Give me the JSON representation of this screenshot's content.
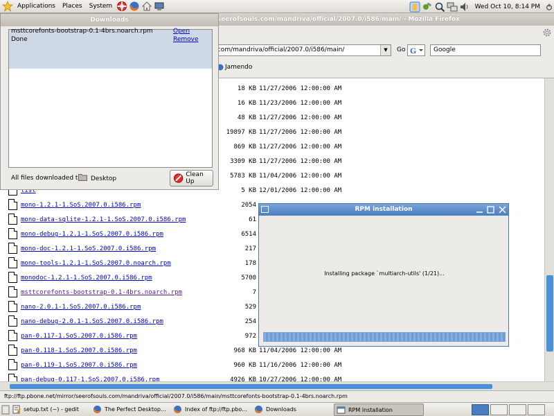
{
  "top_panel": {
    "menus": [
      "Applications",
      "Places",
      "System"
    ],
    "launcher_icons": [
      "lifebuoy-icon",
      "firefox-icon",
      "home-icon",
      "computer-icon"
    ],
    "tray_icons": [
      "update-notifier-icon",
      "tools-icon",
      "search-icon",
      "network-icon",
      "volume-icon"
    ],
    "clock": "Wed Oct 10,  8:14 PM"
  },
  "firefox": {
    "title": "Index of ftp://ftp.pbone.net/mirror/seerofsouls.com/mandriva/official/2007.0/i586/main/ - Mozilla Firefox",
    "url": "ftp://ftp.pbone.net/mirror/seerofsouls.com/mandriva/official/2007.0/i586/main/",
    "url_visible": ".com/mandriva/official/2007.0/i586/main/",
    "go_label": "Go",
    "search_text": "Google",
    "bookmark": "Jamendo",
    "status": "ftp://ftp.pbone.net/mirror/seerofsouls.com/mandriva/official/2007.0/i586/main/msttcorefonts-bootstrap-0.1-4brs.noarch.rpm"
  },
  "listing": [
    {
      "name": "",
      "size": "18 KB",
      "date": "11/27/2006 12:00:00 AM"
    },
    {
      "name": "",
      "size": "16 KB",
      "date": "11/23/2006 12:00:00 AM"
    },
    {
      "name": "",
      "size": "48 KB",
      "date": "11/27/2006 12:00:00 AM"
    },
    {
      "name": "",
      "size": "19897 KB",
      "date": "11/27/2006 12:00:00 AM"
    },
    {
      "name": "",
      "size": "869 KB",
      "date": "11/27/2006 12:00:00 AM"
    },
    {
      "name": "",
      "size": "3309 KB",
      "date": "11/27/2006 12:00:00 AM"
    },
    {
      "name": "",
      "size": "5783 KB",
      "date": "11/04/2006 12:00:00 AM"
    },
    {
      "name": "list",
      "size": "5 KB",
      "date": "12/01/2006 12:00:00 AM"
    },
    {
      "name": "mono-1.2.1-1.SoS.2007.0.i586.rpm",
      "size": "2054",
      "date": ""
    },
    {
      "name": "mono-data-sqlite-1.2.1-1.SoS.2007.0.i586.rpm",
      "size": "61",
      "date": ""
    },
    {
      "name": "mono-debug-1.2.1-1.SoS.2007.0.i586.rpm",
      "size": "6514",
      "date": ""
    },
    {
      "name": "mono-doc-1.2.1-1.SoS.2007.0.i586.rpm",
      "size": "217",
      "date": ""
    },
    {
      "name": "mono-tools-1.2.1-1.SoS.2007.0.noarch.rpm",
      "size": "178",
      "date": ""
    },
    {
      "name": "monodoc-1.2.1-1.SoS.2007.0.i586.rpm",
      "size": "5700",
      "date": ""
    },
    {
      "name": "msttcorefonts-bootstrap-0.1-4brs.noarch.rpm",
      "size": "7",
      "date": "",
      "visited": true
    },
    {
      "name": "nano-2.0.1-1.SoS.2007.0.i586.rpm",
      "size": "529",
      "date": ""
    },
    {
      "name": "nano-debug-2.0.1-1.SoS.2007.0.i586.rpm",
      "size": "254",
      "date": ""
    },
    {
      "name": "pan-0.117-1.SoS.2007.0.i586.rpm",
      "size": "972",
      "date": ""
    },
    {
      "name": "pan-0.118-1.SoS.2007.0.i586.rpm",
      "size": "968 KB",
      "date": "11/04/2006 12:00:00 AM"
    },
    {
      "name": "pan-0.119-1.SoS.2007.0.i586.rpm",
      "size": "960 KB",
      "date": "11/16/2006 12:00:00 AM"
    },
    {
      "name": "pan-debug-0.117-1.SoS.2007.0.i586.rpm",
      "size": "4926 KB",
      "date": "10/27/2006 12:00:00 AM"
    }
  ],
  "downloads": {
    "title": "Downloads",
    "filename": "msttcorefonts-bootstrap-0.1-4brs.noarch.rpm",
    "status": "Done",
    "open": "Open",
    "remove": "Remove",
    "footer_label": "All files downloaded to:",
    "folder": "Desktop",
    "cleanup": "Clean Up"
  },
  "rpm": {
    "title": "RPM installation",
    "message": "Installing package `multiarch-utils' (1/21)...",
    "progress": 1.0
  },
  "taskbar": {
    "tasks": [
      {
        "label": "setup.txt (~) - gedit",
        "icon": "text-editor-icon"
      },
      {
        "label": "The Perfect Desktop...",
        "icon": "firefox-icon"
      },
      {
        "label": "Index of ftp://ftp.pbo...",
        "icon": "firefox-icon"
      },
      {
        "label": "Downloads",
        "icon": "firefox-icon"
      },
      {
        "label": "RPM installation",
        "icon": "window-icon"
      }
    ]
  },
  "colors": {
    "link": "#0000cc",
    "visited": "#551a8b",
    "selection": "#4a7dc0"
  }
}
